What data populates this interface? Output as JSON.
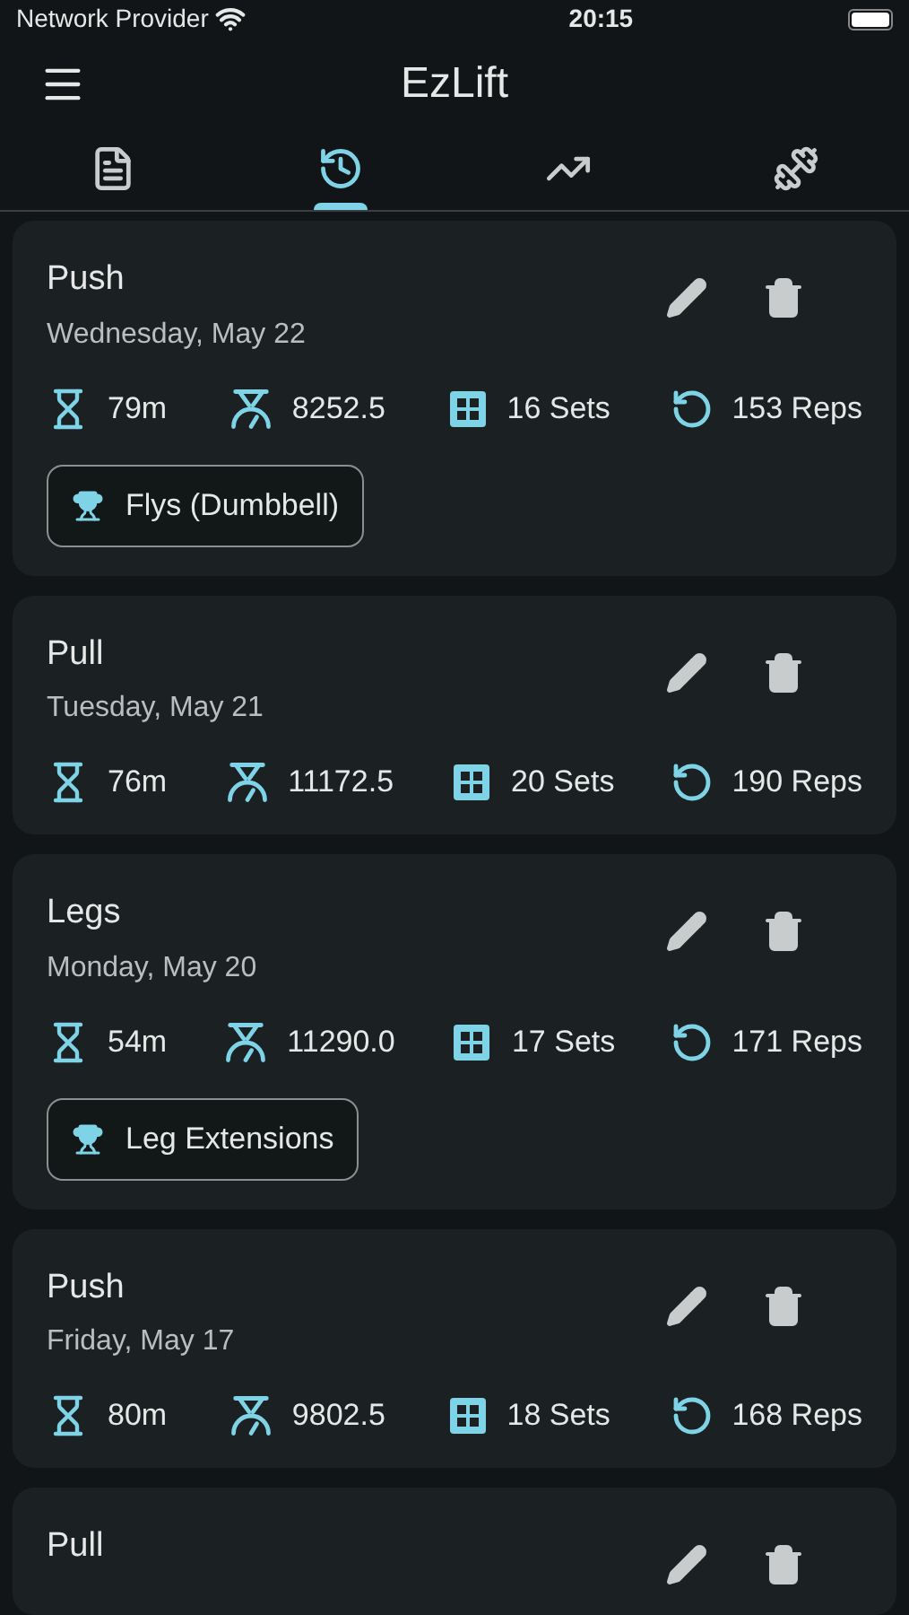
{
  "status_bar": {
    "carrier": "Network Provider",
    "time": "20:15"
  },
  "app_bar": {
    "title": "EzLift"
  },
  "tabs": [
    {
      "kind": "document",
      "selected": false
    },
    {
      "kind": "history",
      "selected": true
    },
    {
      "kind": "chart",
      "selected": false
    },
    {
      "kind": "dumbbell",
      "selected": false
    }
  ],
  "workouts": [
    {
      "title": "Push",
      "date": "Wednesday, May 22",
      "stats": [
        {
          "kind": "duration",
          "text": "79m"
        },
        {
          "kind": "volume",
          "text": "8252.5"
        },
        {
          "kind": "sets",
          "text": "16 Sets"
        },
        {
          "kind": "reps",
          "text": "153 Reps"
        }
      ],
      "records": [
        "Flys (Dumbbell)"
      ]
    },
    {
      "title": "Pull",
      "date": "Tuesday, May 21",
      "stats": [
        {
          "kind": "duration",
          "text": "76m"
        },
        {
          "kind": "volume",
          "text": "11172.5"
        },
        {
          "kind": "sets",
          "text": "20 Sets"
        },
        {
          "kind": "reps",
          "text": "190 Reps"
        }
      ]
    },
    {
      "title": "Legs",
      "date": "Monday, May 20",
      "stats": [
        {
          "kind": "duration",
          "text": "54m"
        },
        {
          "kind": "volume",
          "text": "11290.0"
        },
        {
          "kind": "sets",
          "text": "17 Sets"
        },
        {
          "kind": "reps",
          "text": "171 Reps"
        }
      ],
      "records": [
        "Leg Extensions"
      ]
    },
    {
      "title": "Push",
      "date": "Friday, May 17",
      "stats": [
        {
          "kind": "duration",
          "text": "80m"
        },
        {
          "kind": "volume",
          "text": "9802.5"
        },
        {
          "kind": "sets",
          "text": "18 Sets"
        },
        {
          "kind": "reps",
          "text": "168 Reps"
        }
      ]
    },
    {
      "title": "Pull"
    }
  ]
}
